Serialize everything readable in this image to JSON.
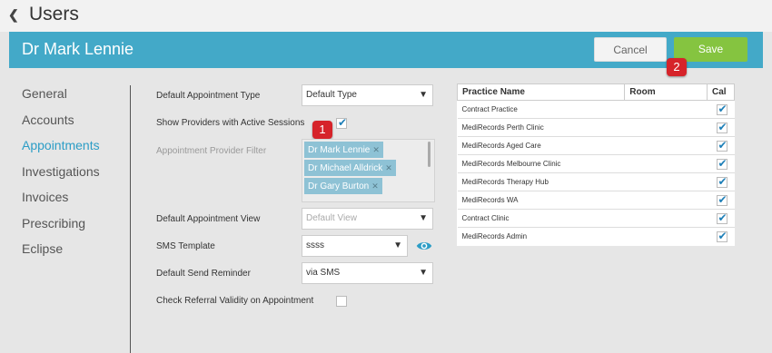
{
  "nav": {
    "back_icon": "chevron-left-icon",
    "title": "Users"
  },
  "header": {
    "user_name": "Dr Mark Lennie",
    "cancel_label": "Cancel",
    "save_label": "Save"
  },
  "badges": {
    "one": "1",
    "two": "2"
  },
  "sidebar": {
    "items": [
      {
        "label": "General",
        "active": false
      },
      {
        "label": "Accounts",
        "active": false
      },
      {
        "label": "Appointments",
        "active": true
      },
      {
        "label": "Investigations",
        "active": false
      },
      {
        "label": "Invoices",
        "active": false
      },
      {
        "label": "Prescribing",
        "active": false
      },
      {
        "label": "Eclipse",
        "active": false
      }
    ]
  },
  "form": {
    "default_appt_type": {
      "label": "Default Appointment Type",
      "value": "Default Type"
    },
    "show_providers": {
      "label": "Show Providers with Active Sessions",
      "checked": true
    },
    "provider_filter": {
      "label": "Appointment Provider Filter",
      "tags": [
        "Dr Mark Lennie",
        "Dr Michael Alldrick",
        "Dr Gary Burton"
      ]
    },
    "default_appt_view": {
      "label": "Default Appointment View",
      "placeholder": "Default View"
    },
    "sms_template": {
      "label": "SMS Template",
      "value": "ssss"
    },
    "default_send_reminder": {
      "label": "Default Send Reminder",
      "value": "via SMS"
    },
    "check_referral": {
      "label": "Check Referral Validity on Appointment",
      "checked": false
    }
  },
  "practice_table": {
    "headers": [
      "Practice Name",
      "Room",
      "Cal"
    ],
    "rows": [
      {
        "name": "Contract Practice",
        "checked": true
      },
      {
        "name": "MediRecords Perth Clinic",
        "checked": true
      },
      {
        "name": "MediRecords Aged Care",
        "checked": true
      },
      {
        "name": "MediRecords Melbourne Clinic",
        "checked": true
      },
      {
        "name": "MediRecords Therapy Hub",
        "checked": true
      },
      {
        "name": "MediRecords WA",
        "checked": true
      },
      {
        "name": "Contract Clinic",
        "checked": true
      },
      {
        "name": "MediRecords Admin",
        "checked": true
      }
    ]
  },
  "colors": {
    "header": "#43a9c8",
    "save": "#85c440",
    "active_nav": "#2c9dc6",
    "badge": "#d6232a"
  }
}
